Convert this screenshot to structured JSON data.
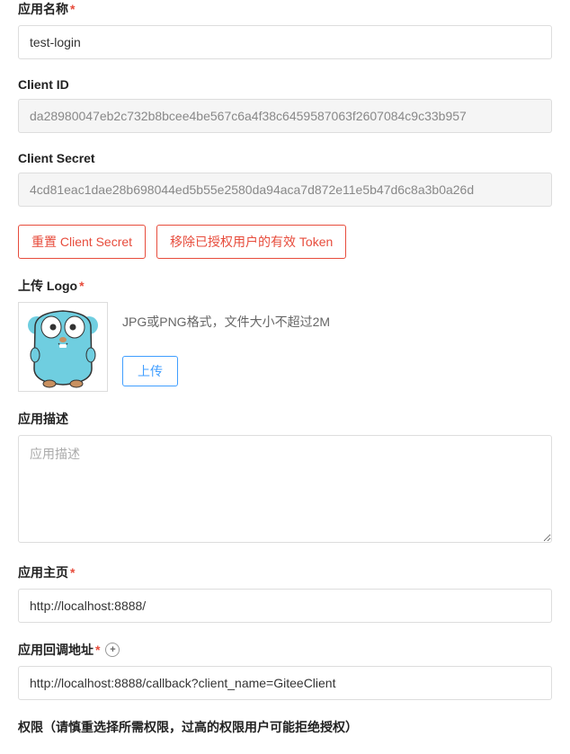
{
  "appName": {
    "label": "应用名称",
    "value": "test-login"
  },
  "clientId": {
    "label": "Client ID",
    "value": "da28980047eb2c732b8bcee4be567c6a4f38c6459587063f2607084c9c33b957"
  },
  "clientSecret": {
    "label": "Client Secret",
    "value": "4cd81eac1dae28b698044ed5b55e2580da94aca7d872e11e5b47d6c8a3b0a26d"
  },
  "buttons": {
    "resetSecret": "重置 Client Secret",
    "removeTokens": "移除已授权用户的有效 Token",
    "upload": "上传"
  },
  "logo": {
    "label": "上传 Logo",
    "hint": "JPG或PNG格式，文件大小不超过2M"
  },
  "description": {
    "label": "应用描述",
    "placeholder": "应用描述"
  },
  "homepage": {
    "label": "应用主页",
    "value": "http://localhost:8888/"
  },
  "callback": {
    "label": "应用回调地址",
    "value": "http://localhost:8888/callback?client_name=GiteeClient"
  },
  "permissions": {
    "label": "权限（请慎重选择所需权限，过高的权限用户可能拒绝授权）"
  }
}
